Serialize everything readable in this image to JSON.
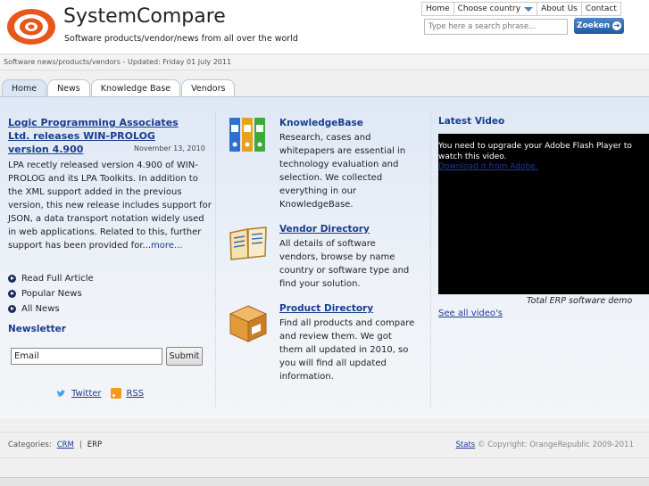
{
  "header": {
    "title": "SystemCompare",
    "tagline": "Software products/vendor/news from all over the world",
    "nav": [
      "Home",
      "Choose country",
      "About Us",
      "Contact"
    ],
    "search_placeholder": "Type here a search phrase...",
    "search_button": "Zoeken"
  },
  "updated_text": "Software news/products/vendors - Updated: Friday 01 July 2011",
  "tabs": [
    "Home",
    "News",
    "Knowledge Base",
    "Vendors"
  ],
  "article": {
    "title": "Logic Programming Associates Ltd. releases WIN-PROLOG version 4.900",
    "date": "November 13, 2010",
    "body": "LPA recetly released version 4.900 of WIN-PROLOG and its LPA Toolkits. In addition to the XML support added in the previous version, this new release includes support for JSON, a data transport notation widely used in web applications. Related to this, further support has been provided for...",
    "more": "more..."
  },
  "left_links": [
    "Read Full Article",
    "Popular News",
    "All News"
  ],
  "newsletter": {
    "title": "Newsletter",
    "email_value": "Email",
    "submit": "Submit"
  },
  "social": {
    "twitter": "Twitter",
    "rss": "RSS"
  },
  "middle": [
    {
      "title": "KnowledgeBase",
      "body": "Research, cases and whitepapers are essential in technology evaluation and selection. We collected everything in our KnowledgeBase.",
      "icon": "binders-icon"
    },
    {
      "title": "Vendor Directory",
      "body": "All details of software vendors, browse by name country or software type and find your solution.",
      "icon": "open-book-icon"
    },
    {
      "title": "Product Directory",
      "body": "Find all products and compare and review them. We got them all updated in 2010, so you will find all updated information.",
      "icon": "package-box-icon"
    }
  ],
  "video": {
    "title": "Latest Video",
    "message": "You need to upgrade your Adobe Flash Player to watch this video.",
    "link": "Download it from Adobe.",
    "caption": "Total ERP software demo",
    "all_videos": "See all video's"
  },
  "footer": {
    "categories_label": "Categories:",
    "categories": [
      "CRM",
      "ERP"
    ],
    "stats": "Stats",
    "copyright": "© Copyright: OrangeRepublic 2009-2011"
  },
  "colors": {
    "link": "#1a3d8f",
    "accent": "#1e5aa0",
    "logo": "#e8571a"
  }
}
